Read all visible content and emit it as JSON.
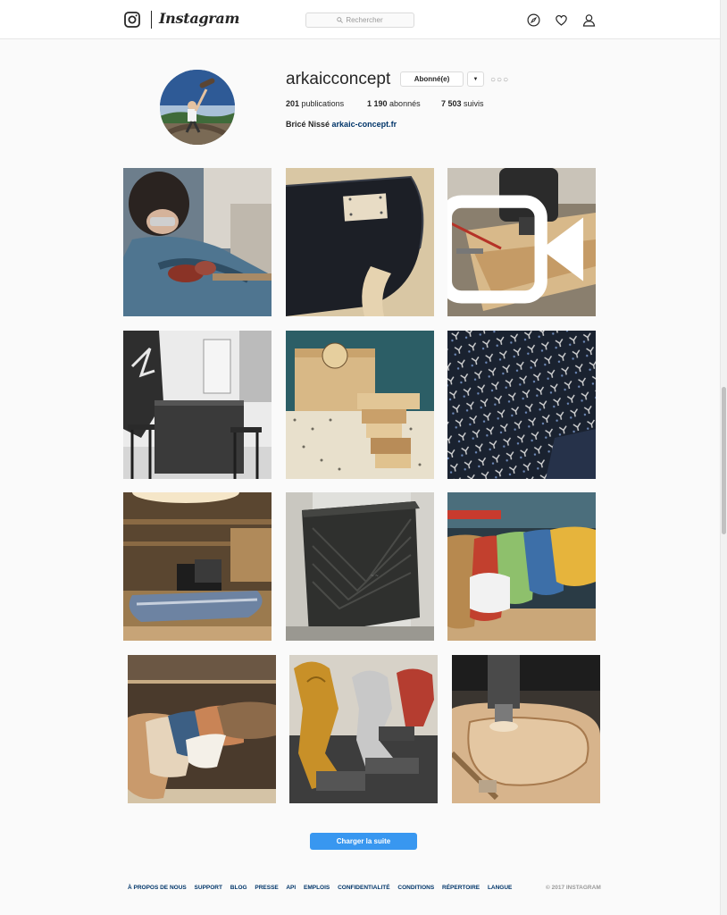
{
  "header": {
    "wordmark": "Instagram",
    "search_placeholder": "Rechercher",
    "icons": [
      "instagram-logo-icon",
      "compass-icon",
      "heart-icon",
      "person-icon"
    ]
  },
  "profile": {
    "username": "arkaicconcept",
    "follow_label": "Abonné(e)",
    "dropdown_label": "▼",
    "more_label": "○○○",
    "stats": [
      {
        "value": "201",
        "label": "publications"
      },
      {
        "value": "1 190",
        "label": "abonnés"
      },
      {
        "value": "7 503",
        "label": "suivis"
      }
    ],
    "bio_name": "Bricé Nissé",
    "bio_link": "arkaic-concept.fr"
  },
  "posts": [
    {
      "subject": "person-sanding-board"
    },
    {
      "subject": "carbon-skateboard-deck"
    },
    {
      "subject": "cnc-machine-milling",
      "video": true
    },
    {
      "subject": "workshop-bar-counter"
    },
    {
      "subject": "wooden-crates-pegboard"
    },
    {
      "subject": "printed-fabric-pattern"
    },
    {
      "subject": "office-with-decks"
    },
    {
      "subject": "black-counter-module"
    },
    {
      "subject": "colorful-deck-stack"
    },
    {
      "subject": "decks-on-shelf"
    },
    {
      "subject": "lion-trophies"
    },
    {
      "subject": "cnc-cutting-wood"
    }
  ],
  "load_more_label": "Charger la suite",
  "footer": {
    "links": [
      "À PROPOS DE NOUS",
      "SUPPORT",
      "BLOG",
      "PRESSE",
      "API",
      "EMPLOIS",
      "CONFIDENTIALITÉ",
      "CONDITIONS",
      "RÉPERTOIRE",
      "LANGUE"
    ],
    "copyright": "© 2017 INSTAGRAM"
  },
  "colors": {
    "accent": "#3897f0",
    "link": "#003569",
    "background": "#fafafa"
  }
}
